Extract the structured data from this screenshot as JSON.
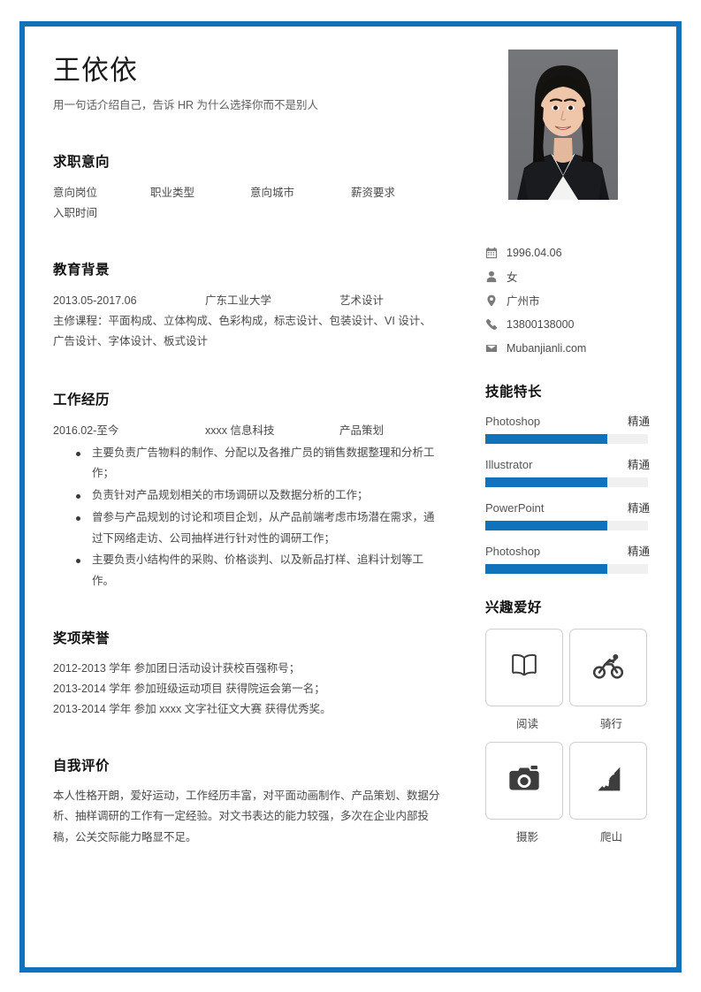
{
  "theme": {
    "accent": "#1072bb",
    "text": "#4a4a4a",
    "heading": "#111111",
    "bar_track": "#f0f0f0"
  },
  "header": {
    "name": "王依依",
    "tagline": "用一句话介绍自己，告诉 HR 为什么选择你而不是别人"
  },
  "job_intention": {
    "heading": "求职意向",
    "fields": [
      "意向岗位",
      "职业类型",
      "意向城市",
      "薪资要求",
      "入职时间"
    ]
  },
  "education": {
    "heading": "教育背景",
    "entry": {
      "date": "2013.05-2017.06",
      "school": "广东工业大学",
      "major": "艺术设计"
    },
    "courses": "主修课程：平面构成、立体构成、色彩构成，标志设计、包装设计、VI 设计、广告设计、字体设计、板式设计"
  },
  "work": {
    "heading": "工作经历",
    "entry": {
      "date": "2016.02-至今",
      "company": "xxxx 信息科技",
      "role": "产品策划"
    },
    "bullets": [
      "主要负责广告物料的制作、分配以及各推广员的销售数据整理和分析工作；",
      "负责针对产品规划相关的市场调研以及数据分析的工作；",
      "曾参与产品规划的讨论和项目企划，从产品前端考虑市场潜在需求，通过下网络走访、公司抽样进行针对性的调研工作；",
      "主要负责小结构件的采购、价格谈判、以及新品打样、追料计划等工作。"
    ]
  },
  "awards": {
    "heading": "奖项荣誉",
    "items": [
      "2012-2013 学年  参加团日活动设计获校百强称号；",
      "2013-2014 学年  参加班级运动项目  获得院运会第一名；",
      "2013-2014 学年  参加 xxxx 文字社征文大赛  获得优秀奖。"
    ]
  },
  "self_evaluation": {
    "heading": "自我评价",
    "text": "本人性格开朗，爱好运动，工作经历丰富，对平面动画制作、产品策划、数据分析、抽样调研的工作有一定经验。对文书表达的能力较强，多次在企业内部投稿，公关交际能力略显不足。"
  },
  "photo": {
    "alt": "证件照"
  },
  "contact": [
    {
      "icon": "calendar-icon",
      "value": "1996.04.06"
    },
    {
      "icon": "person-icon",
      "value": "女"
    },
    {
      "icon": "location-icon",
      "value": "广州市"
    },
    {
      "icon": "phone-icon",
      "value": "13800138000"
    },
    {
      "icon": "mail-icon",
      "value": "Mubanjianli.com"
    }
  ],
  "skills": {
    "heading": "技能特长",
    "items": [
      {
        "name": "Photoshop",
        "level": "精通",
        "percent": 75
      },
      {
        "name": "Illustrator",
        "level": "精通",
        "percent": 75
      },
      {
        "name": "PowerPoint",
        "level": "精通",
        "percent": 75
      },
      {
        "name": "Photoshop",
        "level": "精通",
        "percent": 75
      }
    ]
  },
  "hobbies": {
    "heading": "兴趣爱好",
    "items": [
      {
        "icon": "book-icon",
        "label": "阅读"
      },
      {
        "icon": "bicycle-icon",
        "label": "骑行"
      },
      {
        "icon": "camera-icon",
        "label": "摄影"
      },
      {
        "icon": "climbing-icon",
        "label": "爬山"
      }
    ]
  }
}
